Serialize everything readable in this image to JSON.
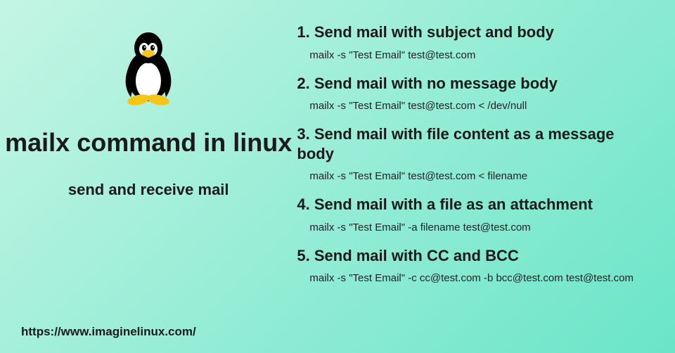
{
  "title": "mailx command in linux",
  "subtitle": "send and receive mail",
  "footer_url": "https://www.imaginelinux.com/",
  "examples": [
    {
      "heading": "1. Send mail with subject and body",
      "command": "mailx -s \"Test Email\" test@test.com"
    },
    {
      "heading": "2. Send mail with no message body",
      "command": "mailx -s \"Test Email\" test@test.com < /dev/null"
    },
    {
      "heading": "3. Send mail with file content as a message body",
      "command": "mailx -s \"Test Email\" test@test.com < filename"
    },
    {
      "heading": "4. Send mail with a file as an attachment",
      "command": "mailx -s \"Test Email\" -a filename test@test.com"
    },
    {
      "heading": "5. Send mail with CC and BCC",
      "command": "mailx -s \"Test Email\" -c cc@test.com -b bcc@test.com test@test.com"
    }
  ]
}
